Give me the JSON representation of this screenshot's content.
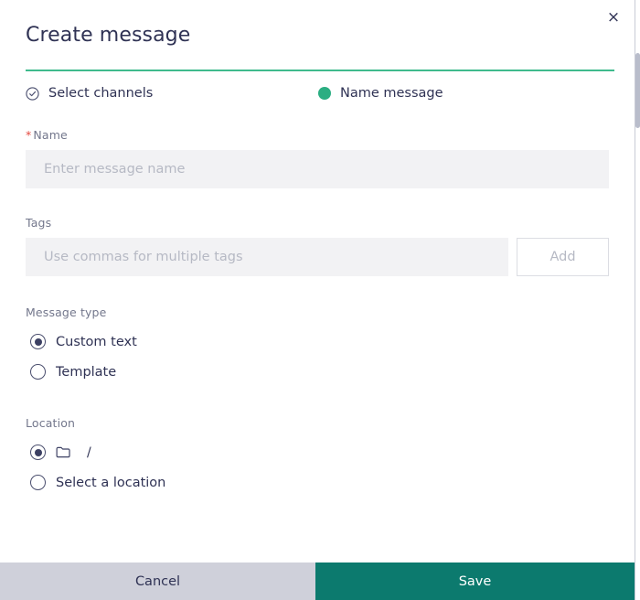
{
  "dialog": {
    "title": "Create message",
    "close_label": "×",
    "close_icon": "close-icon"
  },
  "steps": [
    {
      "label": "Select channels",
      "state": "complete",
      "icon": "check-circle-icon"
    },
    {
      "label": "Name message",
      "state": "active",
      "icon": "filled-dot-icon"
    }
  ],
  "form": {
    "name": {
      "label": "Name",
      "required_marker": "*",
      "placeholder": "Enter message name",
      "value": ""
    },
    "tags": {
      "label": "Tags",
      "placeholder": "Use commas for multiple tags",
      "value": "",
      "add_label": "Add"
    },
    "message_type": {
      "label": "Message type",
      "options": [
        {
          "label": "Custom text",
          "selected": true
        },
        {
          "label": "Template",
          "selected": false
        }
      ]
    },
    "location": {
      "label": "Location",
      "options": [
        {
          "label": "/",
          "icon": "folder-icon",
          "selected": true
        },
        {
          "label": "Select a location",
          "icon": "",
          "selected": false
        }
      ]
    }
  },
  "footer": {
    "cancel_label": "Cancel",
    "save_label": "Save"
  },
  "colors": {
    "accent_green": "#3fba8d",
    "step_dot_green": "#2bae82",
    "save_teal": "#0c7a6e",
    "cancel_gray": "#cfd0da",
    "text_navy": "#2f3254",
    "label_gray": "#73778c",
    "input_bg": "#f2f2f4",
    "placeholder_gray": "#b6b9c4",
    "required_red": "#e4483f"
  }
}
